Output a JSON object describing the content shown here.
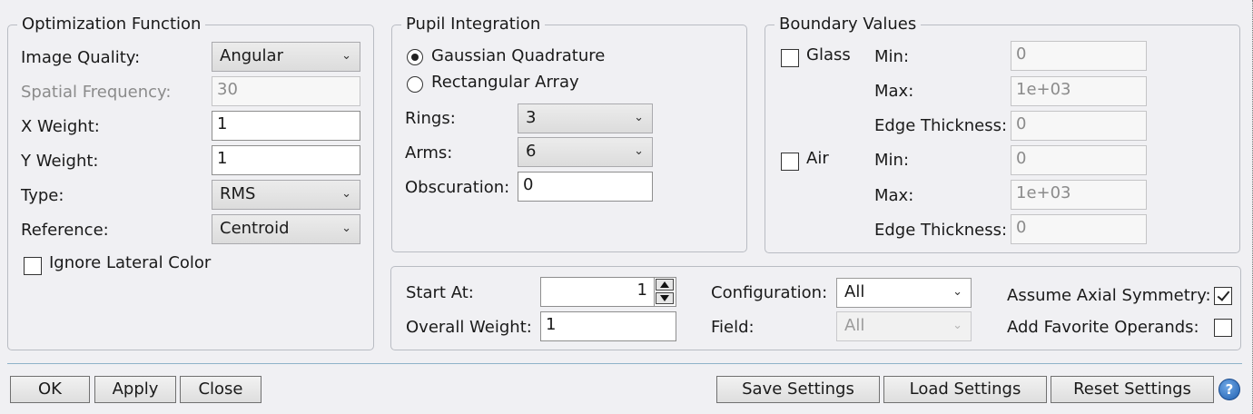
{
  "optimization_function": {
    "title": "Optimization Function",
    "image_quality_label": "Image Quality:",
    "image_quality_value": "Angular",
    "spatial_frequency_label": "Spatial Frequency:",
    "spatial_frequency_value": "30",
    "x_weight_label": "X Weight:",
    "x_weight_value": "1",
    "y_weight_label": "Y Weight:",
    "y_weight_value": "1",
    "type_label": "Type:",
    "type_value": "RMS",
    "reference_label": "Reference:",
    "reference_value": "Centroid",
    "ignore_lateral_color_label": "Ignore Lateral Color",
    "ignore_lateral_color_checked": false
  },
  "pupil_integration": {
    "title": "Pupil Integration",
    "gaussian_label": "Gaussian Quadrature",
    "rectangular_label": "Rectangular Array",
    "selected": "Gaussian Quadrature",
    "rings_label": "Rings:",
    "rings_value": "3",
    "arms_label": "Arms:",
    "arms_value": "6",
    "obscuration_label": "Obscuration:",
    "obscuration_value": "0"
  },
  "boundary_values": {
    "title": "Boundary Values",
    "glass_label": "Glass",
    "glass_checked": false,
    "glass_min_label": "Min:",
    "glass_min_value": "0",
    "glass_max_label": "Max:",
    "glass_max_value": "1e+03",
    "glass_edge_label": "Edge Thickness:",
    "glass_edge_value": "0",
    "air_label": "Air",
    "air_checked": false,
    "air_min_label": "Min:",
    "air_min_value": "0",
    "air_max_label": "Max:",
    "air_max_value": "1e+03",
    "air_edge_label": "Edge Thickness:",
    "air_edge_value": "0"
  },
  "general": {
    "start_at_label": "Start At:",
    "start_at_value": "1",
    "overall_weight_label": "Overall Weight:",
    "overall_weight_value": "1",
    "configuration_label": "Configuration:",
    "configuration_value": "All",
    "field_label": "Field:",
    "field_value": "All",
    "assume_axial_symmetry_label": "Assume Axial Symmetry:",
    "assume_axial_symmetry_checked": true,
    "add_favorite_operands_label": "Add Favorite Operands:",
    "add_favorite_operands_checked": false
  },
  "buttons": {
    "ok": "OK",
    "apply": "Apply",
    "close": "Close",
    "save_settings": "Save Settings",
    "load_settings": "Load Settings",
    "reset_settings": "Reset Settings",
    "help_icon": "help-icon",
    "help_glyph": "?"
  }
}
